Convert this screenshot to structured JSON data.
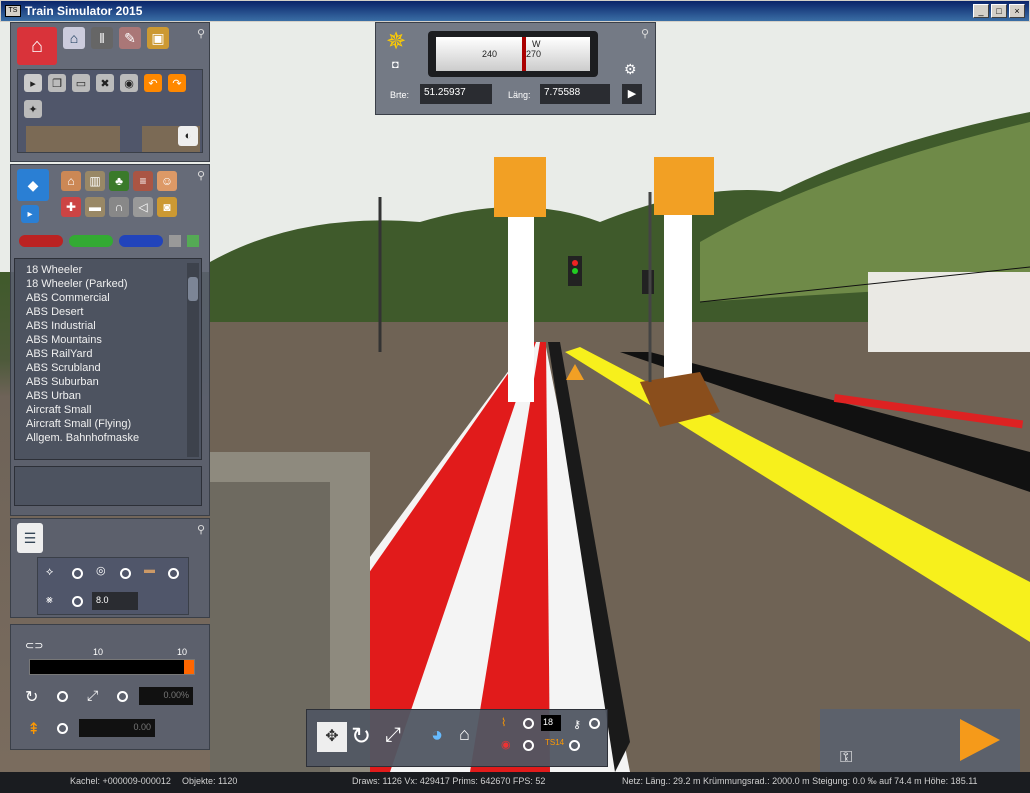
{
  "window": {
    "title": "Train Simulator 2015",
    "icon_text": "TS",
    "controls": [
      "_",
      "□",
      "×"
    ]
  },
  "compass": {
    "tick_240": "240",
    "tick_270": "270",
    "direction": "W",
    "lat_label": "Brte:",
    "lat_value": "51.25937",
    "lon_label": "Läng:",
    "lon_value": "7.75588"
  },
  "objects_list": {
    "items": [
      "18 Wheeler",
      "18 Wheeler (Parked)",
      "ABS Commercial",
      "ABS Desert",
      "ABS Industrial",
      "ABS Mountains",
      "ABS RailYard",
      "ABS Scrubland",
      "ABS Suburban",
      "ABS Urban",
      "Aircraft Small",
      "Aircraft Small (Flying)",
      "Allgem. Bahnhofmaske"
    ]
  },
  "properties": {
    "width_value": "8.0"
  },
  "sliders": {
    "min_label": "10",
    "max_label": "10",
    "angle_value": "0.00%",
    "height_value": "0.00"
  },
  "toolbar": {
    "speed_value": "18",
    "ts_label": "TS14"
  },
  "status": {
    "tile": "Kachel: +000009-000012",
    "objects": "Objekte: 1120",
    "draws": "Draws: 1126 Vx: 429417 Prims: 642670 FPS: 52",
    "network": "Netz:  Läng.:    29.2 m Krümmungsrad.: 2000.0 m Steigung:  0.0 ‰ auf 74.4 m Höhe: 185.11"
  },
  "colors": {
    "accent_red": "#e11b1b",
    "track_yellow": "#f7f01c",
    "panel": "#5a606e",
    "marker_orange": "#f2a024"
  }
}
